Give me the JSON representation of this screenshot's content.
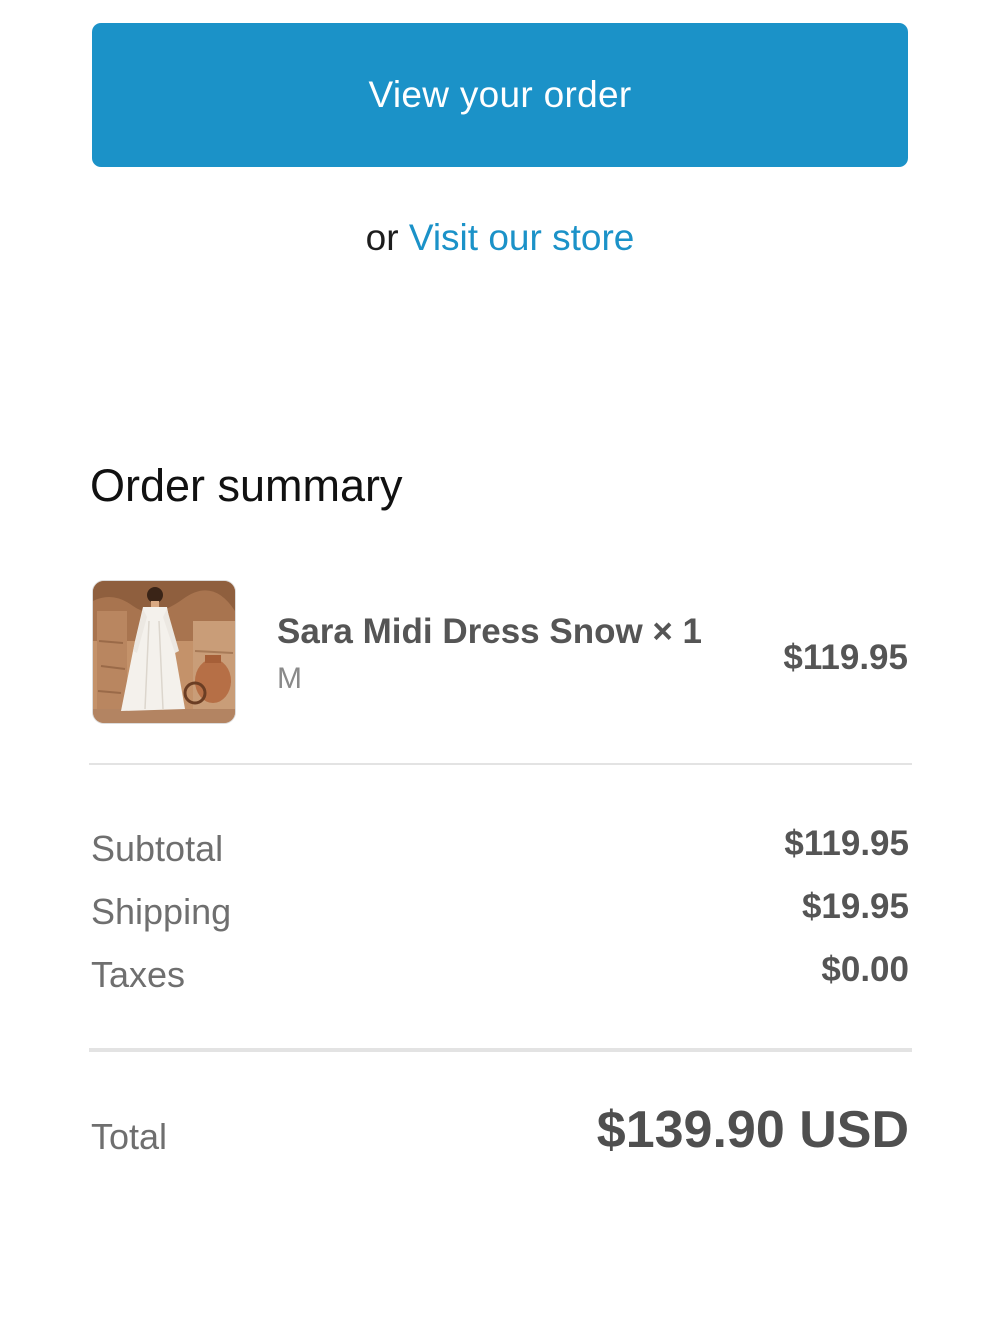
{
  "actions": {
    "view_order_label": "View your order",
    "or_text": "or",
    "visit_store_label": "Visit our store"
  },
  "order_summary": {
    "title": "Order summary",
    "items": [
      {
        "name": "Sara Midi Dress Snow × 1",
        "variant": "M",
        "price": "$119.95",
        "image": "product-photo-white-dress"
      }
    ],
    "costs": {
      "subtotal_label": "Subtotal",
      "subtotal_value": "$119.95",
      "shipping_label": "Shipping",
      "shipping_value": "$19.95",
      "taxes_label": "Taxes",
      "taxes_value": "$0.00"
    },
    "total": {
      "label": "Total",
      "value": "$139.90 USD"
    }
  },
  "colors": {
    "accent": "#1b92c8",
    "text_primary": "#111111",
    "text_muted": "#6f6f6f",
    "value_text": "#555555",
    "divider": "#e3e3e3"
  }
}
